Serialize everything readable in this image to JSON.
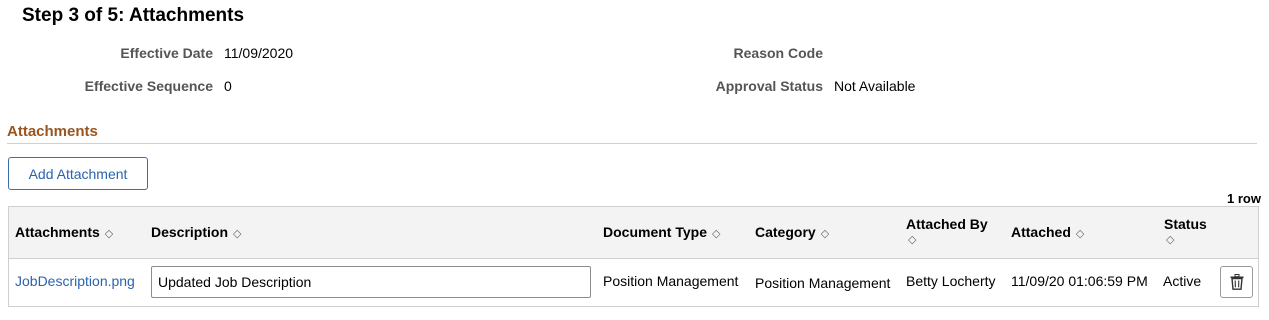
{
  "page": {
    "title": "Step 3 of 5: Attachments"
  },
  "header_fields": {
    "effective_date": {
      "label": "Effective Date",
      "value": "11/09/2020"
    },
    "effective_sequence": {
      "label": "Effective Sequence",
      "value": "0"
    },
    "reason_code": {
      "label": "Reason Code",
      "value": ""
    },
    "approval_status": {
      "label": "Approval Status",
      "value": "Not Available"
    }
  },
  "attachments_section": {
    "heading": "Attachments",
    "add_button_label": "Add Attachment",
    "row_count": "1 row",
    "columns": [
      "Attachments",
      "Description",
      "Document Type",
      "Category",
      "Attached By",
      "Attached",
      "Status"
    ],
    "rows": [
      {
        "attachment": "JobDescription.png",
        "description": "Updated Job Description",
        "document_type": "Position Management",
        "category": "Position Management",
        "attached_by": "Betty Locherty",
        "attached": "11/09/20 01:06:59 PM",
        "status": "Active"
      }
    ]
  },
  "icons": {
    "sort": "sort-updown-icon",
    "delete": "trash-icon"
  },
  "colors": {
    "link": "#2a63ad",
    "section_heading": "#995620",
    "label": "#555555"
  }
}
